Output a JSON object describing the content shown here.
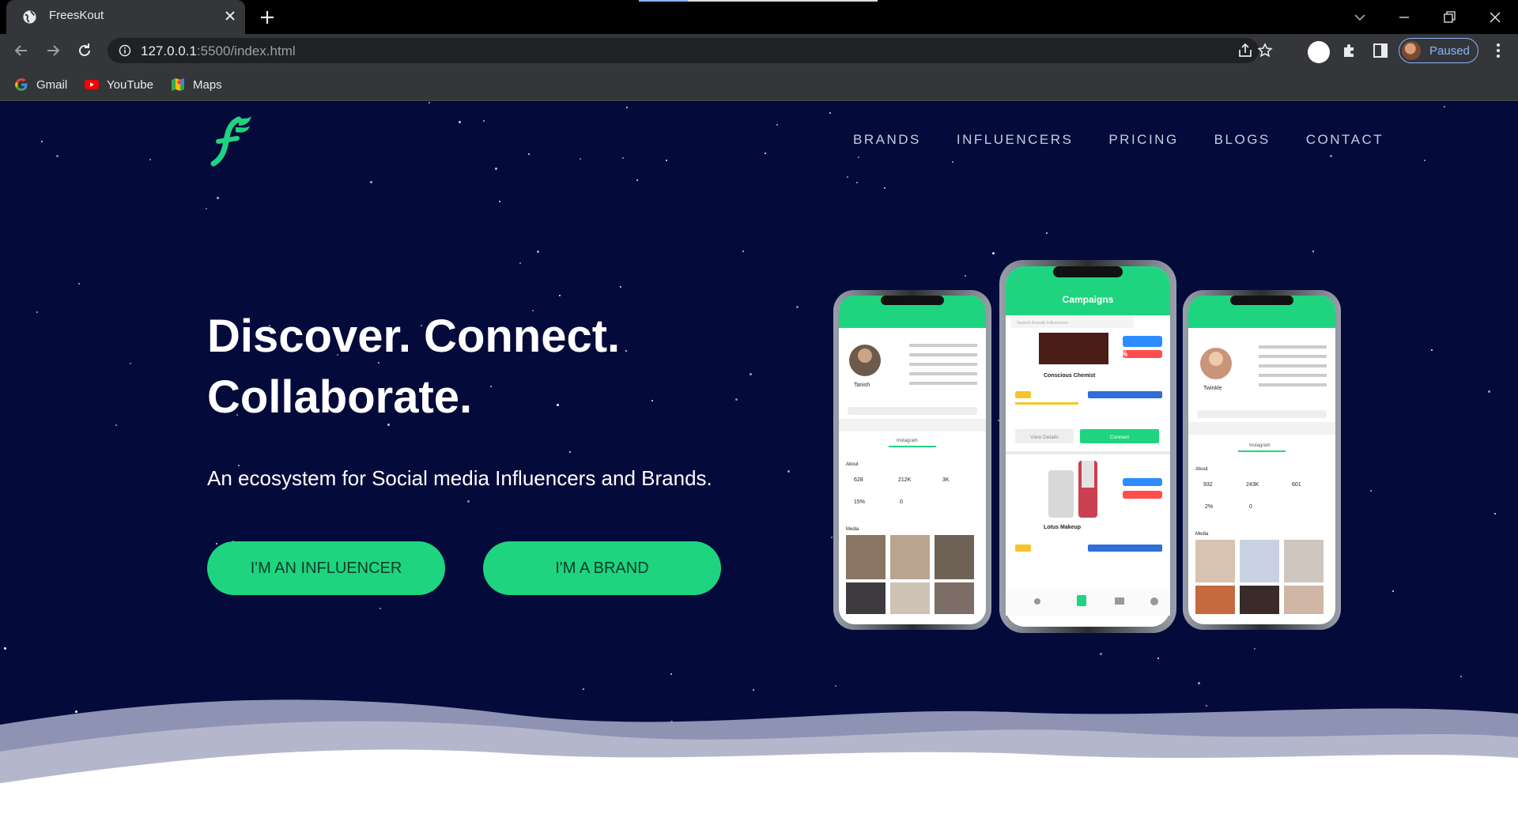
{
  "browser": {
    "tab_title": "FreesKout",
    "url_host": "127.0.0.1",
    "url_path": ":5500/index.html",
    "profile_label": "Paused",
    "bookmarks": [
      {
        "label": "Gmail",
        "icon": "google-icon"
      },
      {
        "label": "YouTube",
        "icon": "youtube-icon"
      },
      {
        "label": "Maps",
        "icon": "maps-icon"
      }
    ]
  },
  "site": {
    "nav": [
      "BRANDS",
      "INFLUENCERS",
      "PRICING",
      "BLOGS",
      "CONTACT"
    ],
    "hero_title_line1": "Discover. Connect.",
    "hero_title_line2": "Collaborate.",
    "hero_subtitle": "An ecosystem for Social media Influencers and Brands.",
    "cta_influencer": "I'M AN INFLUENCER",
    "cta_brand": "I'M A BRAND"
  },
  "mockup": {
    "center_title": "Campaigns",
    "search_placeholder": "Search Brands Influencers",
    "campaign1_name": "Conscious Chemist",
    "campaign1_score": "94%",
    "campaign2_name": "Lotus Makeup",
    "view_details": "View Details",
    "connect": "Connect",
    "left_name": "Tanish",
    "right_name": "Twinkle",
    "about": "About",
    "media": "Media",
    "instagram": "Instagram",
    "left_stats": [
      "628",
      "212K",
      "3K",
      "15%",
      "0"
    ],
    "right_stats": [
      "932",
      "243K",
      "601",
      "2%",
      "0"
    ]
  },
  "colors": {
    "page_bg": "#040b3b",
    "accent": "#1ed47f",
    "chrome": "#35363a"
  }
}
